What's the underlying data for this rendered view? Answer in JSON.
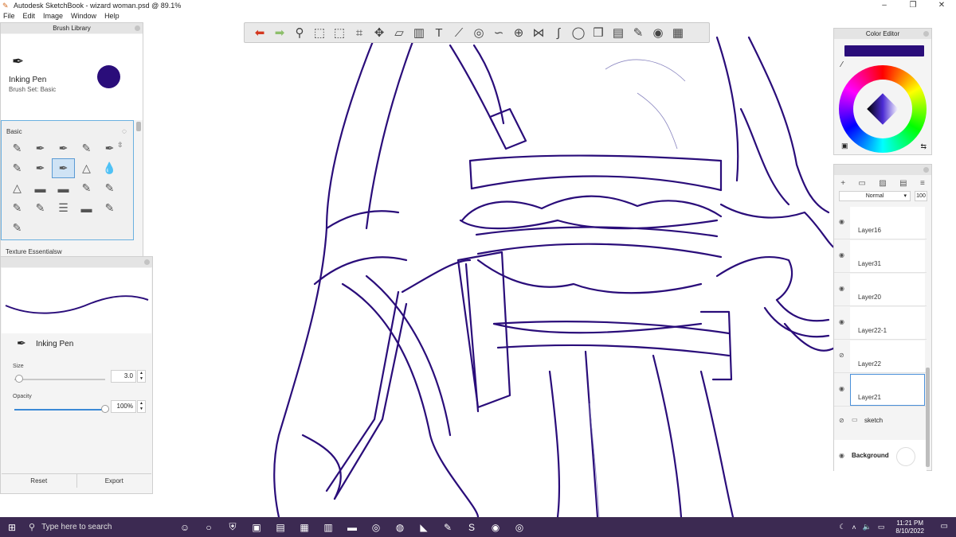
{
  "window": {
    "title": "Autodesk SketchBook - wizard woman.psd @ 89.1%",
    "controls": [
      "–",
      "❐",
      "✕"
    ]
  },
  "menu": [
    "File",
    "Edit",
    "Image",
    "Window",
    "Help"
  ],
  "toolbar": {
    "tools": [
      "undo-icon",
      "redo-icon",
      "zoom-icon",
      "select-icon",
      "lasso-icon",
      "crop-icon",
      "transform-icon",
      "distort-icon",
      "fill-icon",
      "text-icon",
      "ruler-icon",
      "ellipse-icon",
      "french-curve-icon",
      "perspective-icon",
      "symmetry-icon",
      "stroke-icon",
      "predictive-icon",
      "shape-icon",
      "layer-editor-icon",
      "brush-library-icon",
      "color-wheel-icon",
      "copic-icon"
    ]
  },
  "brush_library": {
    "header": "Brush Library",
    "current_brush_name": "Inking Pen",
    "current_brush_set": "Brush Set: Basic",
    "current_color": "#2a0d7a",
    "section_basic": "Basic",
    "section_texture": "Texture Essentialsw",
    "brush_icons": [
      "✎",
      "✒",
      "✒",
      "✎",
      "✒",
      "✎",
      "✒",
      "✒",
      "△",
      "💧",
      "△",
      "▬",
      "▬",
      "✎",
      "✎",
      "✎",
      "✎",
      "☰",
      "▬",
      "✎",
      "✎"
    ]
  },
  "brush_properties": {
    "brush_name": "Inking Pen",
    "size_label": "Size",
    "size_value": "3.0",
    "size_level_percent": 5,
    "opacity_label": "Opacity",
    "opacity_value": "100%",
    "opacity_level_percent": 100,
    "reset_label": "Reset",
    "export_label": "Export"
  },
  "color_editor": {
    "header": "Color Editor",
    "color": "#2a0d7a"
  },
  "layers": {
    "blend_mode": "Normal",
    "opacity": "100",
    "items": [
      {
        "name": "Layer16"
      },
      {
        "name": "Layer31"
      },
      {
        "name": "Layer20"
      },
      {
        "name": "Layer22-1"
      },
      {
        "name": "Layer22"
      },
      {
        "name": "Layer21"
      }
    ],
    "group_name": "sketch",
    "background_name": "Background"
  },
  "taskbar": {
    "search_placeholder": "Type here to search",
    "time": "11:21 PM",
    "date": "8/10/2022"
  }
}
